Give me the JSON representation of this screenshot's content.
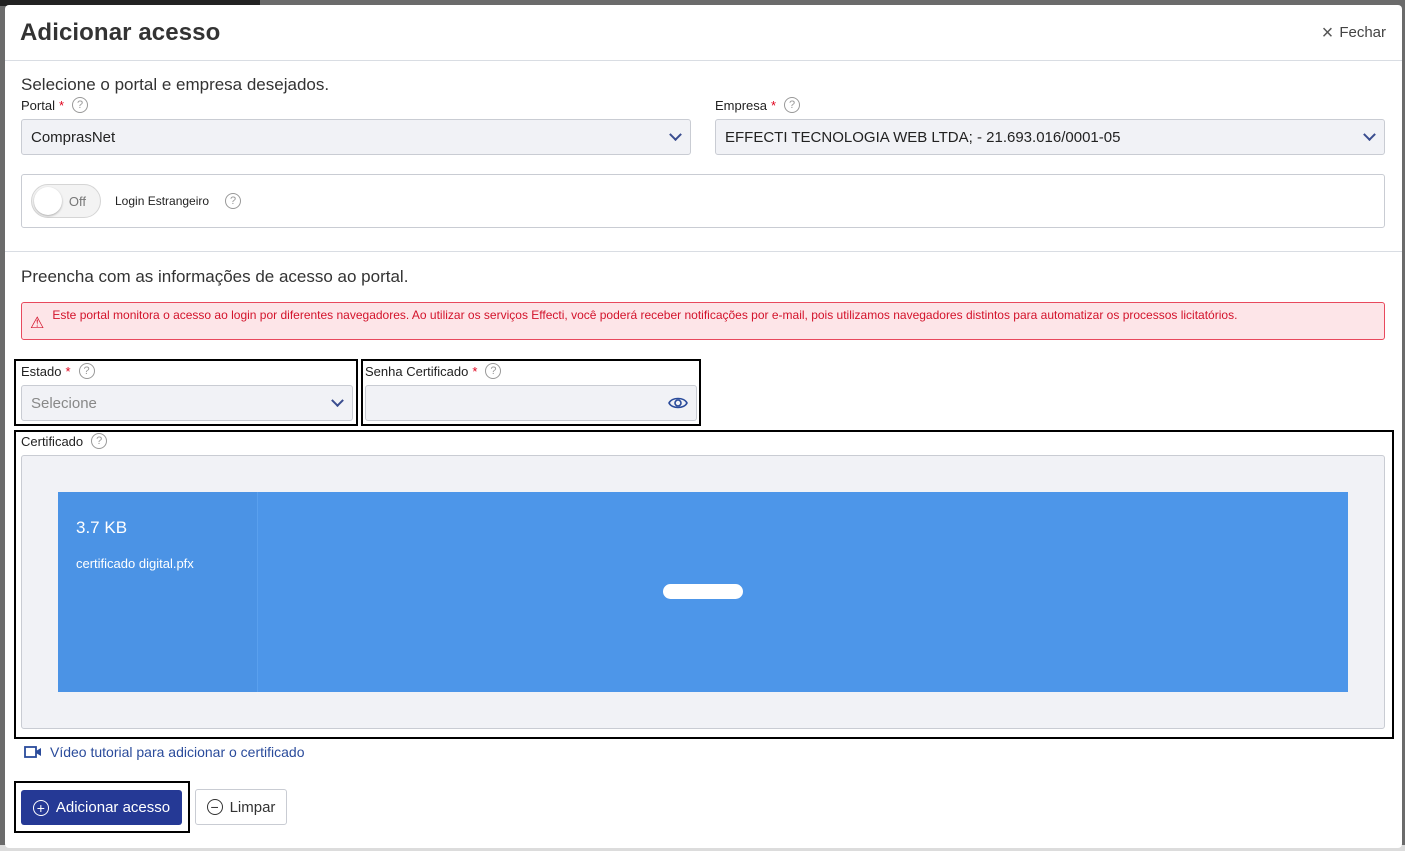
{
  "modal": {
    "title": "Adicionar acesso",
    "close_label": "Fechar"
  },
  "portal_section": {
    "title": "Selecione o portal e empresa desejados.",
    "portal_label": "Portal",
    "portal_value": "ComprasNet",
    "empresa_label": "Empresa",
    "empresa_value": "EFFECTI TECNOLOGIA WEB LTDA; - 21.693.016/0001-05",
    "toggle_state": "Off",
    "toggle_label": "Login Estrangeiro"
  },
  "access_section": {
    "title": "Preencha com as informações de acesso ao portal.",
    "alert_text": "Este portal monitora o acesso ao login por diferentes navegadores. Ao utilizar os serviços Effecti, você poderá receber notificações por e-mail, pois utilizamos navegadores distintos para automatizar os processos licitatórios.",
    "estado_label": "Estado",
    "estado_placeholder": "Selecione",
    "senha_label": "Senha Certificado",
    "certificado_label": "Certificado",
    "file_size": "3.7 KB",
    "file_name": "certificado digital.pfx",
    "tutorial_link": "Vídeo tutorial para adicionar o certificado"
  },
  "actions": {
    "submit_label": "Adicionar acesso",
    "clear_label": "Limpar"
  },
  "colors": {
    "primary": "#253995",
    "file_card": "#4d96e9",
    "alert_text": "#d3132b",
    "alert_bg": "#fde5e8"
  }
}
